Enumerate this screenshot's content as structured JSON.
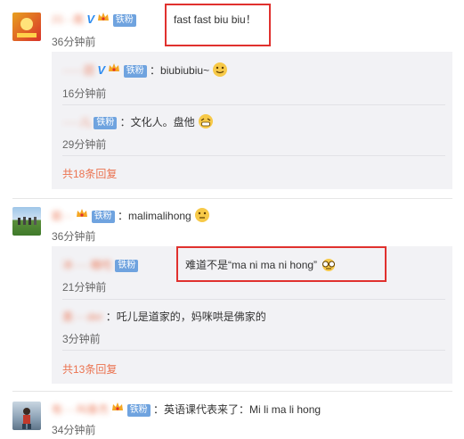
{
  "comments": [
    {
      "name": "川···南",
      "fan_label": "铁粉",
      "text": "fast fast biu biu！",
      "time": "36分钟前",
      "replies": [
        {
          "name": "······团",
          "fan_label": "铁粉",
          "text": "：biubiubiu~",
          "time": "16分钟前"
        },
        {
          "name": "·····儿",
          "fan_label": "铁粉",
          "text": "：文化人。盘他",
          "time": "29分钟前"
        }
      ],
      "more": "共18条回复"
    },
    {
      "name": "能···",
      "fan_label": "铁粉",
      "text": "：malimalihong",
      "time": "36分钟前",
      "replies": [
        {
          "name": "冰·····糖吃",
          "fan_label": "铁粉",
          "text": "难道不是“ma ni ma ni hong”",
          "time": "21分钟前"
        },
        {
          "name": "墨····der",
          "fan_label": "",
          "text": "：吒儿是道家的，妈咪哄是佛家的",
          "time": "3分钟前"
        }
      ],
      "more": "共13条回复"
    },
    {
      "name": "有····叫泰杰",
      "fan_label": "铁粉",
      "text": "：英语课代表来了：Mi li ma li hong",
      "time": "34分钟前"
    }
  ],
  "colors": {
    "name": "#eb7350",
    "fan_badge": "#6fa3df",
    "highlight_box": "#e0312e",
    "reply_bg": "#f2f2f5"
  }
}
